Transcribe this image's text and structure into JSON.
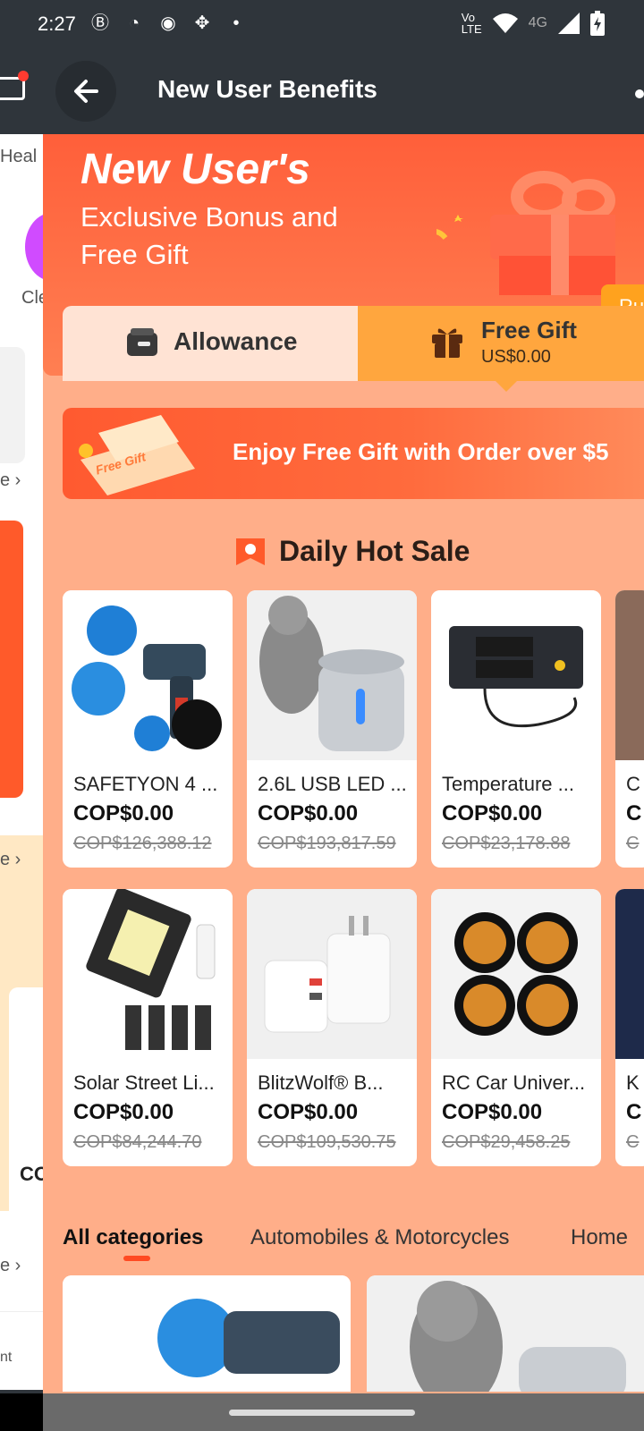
{
  "status_bar": {
    "time": "2:27",
    "network_label": "4G"
  },
  "underlay": {
    "text_1": "Heal",
    "text_2": "Cle",
    "text_3": "e ›",
    "text_4": "e ›",
    "text_5": "CO",
    "text_6": "e ›",
    "text_7": "nt"
  },
  "header": {
    "title": "New User Benefits"
  },
  "hero": {
    "title": "New User's",
    "subtitle": "Exclusive Bonus and Free Gift",
    "rules_label": "Ru"
  },
  "tabs": {
    "allowance_label": "Allowance",
    "free_gift_label": "Free Gift",
    "free_gift_value": "US$0.00"
  },
  "banner": {
    "ticket_text": "Free Gift",
    "text": "Enjoy Free Gift with Order over $5"
  },
  "section": {
    "title": "Daily Hot Sale"
  },
  "products": [
    {
      "name": "SAFETYON 4 ...",
      "price": "COP$0.00",
      "original_price": "COP$126,388.12"
    },
    {
      "name": "2.6L USB LED ...",
      "price": "COP$0.00",
      "original_price": "COP$193,817.59"
    },
    {
      "name": "Temperature ...",
      "price": "COP$0.00",
      "original_price": "COP$23,178.88"
    },
    {
      "name": "C",
      "price": "C",
      "original_price": "C"
    },
    {
      "name": "Solar Street Li...",
      "price": "COP$0.00",
      "original_price": "COP$84,244.70"
    },
    {
      "name": "BlitzWolf® B...",
      "price": "COP$0.00",
      "original_price": "COP$109,530.75"
    },
    {
      "name": "RC Car Univer...",
      "price": "COP$0.00",
      "original_price": "COP$29,458.25"
    },
    {
      "name": "K",
      "price": "C",
      "original_price": "C"
    }
  ],
  "categories": {
    "items": [
      "All categories",
      "Automobiles & Motorcycles",
      "Home"
    ]
  },
  "colors": {
    "accent": "#ff4a22",
    "panel_bg": "#ffae89",
    "free_gift_tab": "#ffa63e"
  }
}
